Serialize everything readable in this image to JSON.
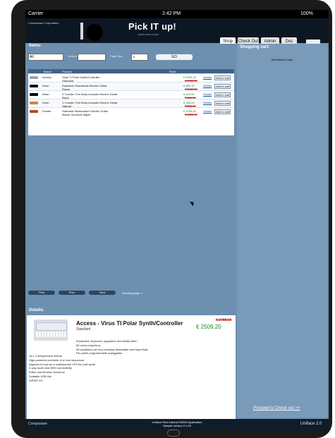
{
  "status": {
    "carrier": "Carrier",
    "time": "2:42 PM",
    "battery": "100%"
  },
  "header": {
    "corp": "Compuware Corporation",
    "title": "Pick IT up!",
    "subtitle": "DEMO APPLICATION",
    "tabs": [
      "Shop",
      "Check Out",
      "Admin",
      "Doc"
    ]
  },
  "items": {
    "title": "Items:",
    "filter": {
      "all": "All",
      "search": "Search",
      "page_size": "Page Size",
      "page_value": "5",
      "go": "GO"
    },
    "headers": {
      "brand": "Brand",
      "product": "Product",
      "price": "Price"
    },
    "rows": [
      {
        "brand": "Access",
        "product1": "Virus TI Polar Synth/Controller",
        "product2": "Standard",
        "new": "€ 2509.20",
        "old": "€ 2788.00",
        "details": "Details",
        "add": "Add to cart"
      },
      {
        "brand": "Dean",
        "product1": "Explosion Razorback Electric Guitar",
        "product2": "Flame",
        "new": "€ 980.10",
        "old": "€ 1089.00",
        "details": "Details",
        "add": "Add to cart"
      },
      {
        "brand": "Dean",
        "product1": "V Coustic Thin Body Acoustic-Electric Guitar",
        "product2": "Black",
        "new": "€ 450.00",
        "old": "€ 500.00",
        "details": "Details",
        "add": "Add to cart"
      },
      {
        "brand": "Dean",
        "product1": "V Coustic Thin Body Acoustic-Electric Guitar",
        "product2": "Natural",
        "new": "€ 180.00",
        "old": "€ 200.00",
        "details": "Details",
        "add": "Add to cart"
      },
      {
        "brand": "Fender",
        "product1": "Standard Stratocaster Electric Guitar",
        "product2": "Brown Sunburst Maple",
        "new": "€ 1099.80",
        "old": "€ 1222.00",
        "details": "Details",
        "add": "Add to cart"
      }
    ],
    "pager": {
      "first": "First",
      "prev": "Prev",
      "next": "Next",
      "showing": "Showing page: 1"
    }
  },
  "details": {
    "title": "Details:",
    "name": "Access - Virus TI Polar Synth/Controller",
    "variant": "Standard",
    "old": "€ 2788.00",
    "new": "€ 2509.20",
    "features": [
      "Expanded, improved, upgraded, and totally killer!",
      "80-voice polyphony",
      "36 oscillators per key including Wavetable and HyperSaw",
      "Per patch programmable arpeggiator"
    ],
    "features2": [
      "16 x 2 delay/reverb effects",
      "High-powered controller of a host sequencer",
      "Appears in host as a multichannel VST/AU soft-synth",
      "2-way audio and MIDI connectivity",
      "Editor and librarian functions",
      "Scalable USB link",
      "S/PDIF I/O"
    ]
  },
  "cart": {
    "title": "Shopping cart:",
    "empty": "No items in cart",
    "checkout": "Proceed to Check out >>"
  },
  "footer": {
    "left": "Compuware",
    "center1": "Uniface Rich Internet DEMO Application",
    "center2": "Sample version 2.1.00",
    "right": "Uniface 2.0"
  }
}
